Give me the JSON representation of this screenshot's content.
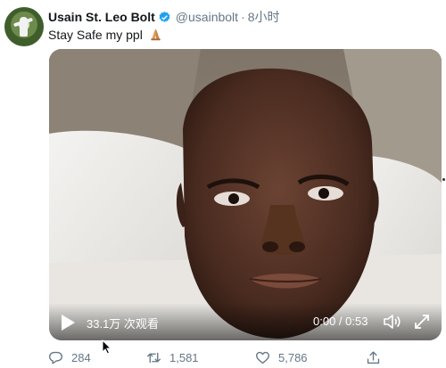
{
  "user": {
    "name": "Usain St. Leo Bolt",
    "handle": "@usainbolt",
    "separator": "·",
    "time": "8小时",
    "verified_color": "#1da1f2",
    "avatar_icon": "avatar-photo"
  },
  "tweet": {
    "text": "Stay Safe my ppl",
    "emoji": "folded-hands-icon"
  },
  "video": {
    "views": "33.1万 次观看",
    "duration": "0:00 / 0:53",
    "play_icon": "play-icon",
    "volume_icon": "volume-icon",
    "fullscreen_icon": "fullscreen-icon"
  },
  "actions": {
    "reply_count": "284",
    "retweet_count": "1,581",
    "like_count": "5,786",
    "icons": [
      "reply-icon",
      "retweet-icon",
      "like-icon",
      "share-icon"
    ]
  },
  "colors": {
    "text_secondary": "#657786",
    "text_primary": "#14171a"
  }
}
